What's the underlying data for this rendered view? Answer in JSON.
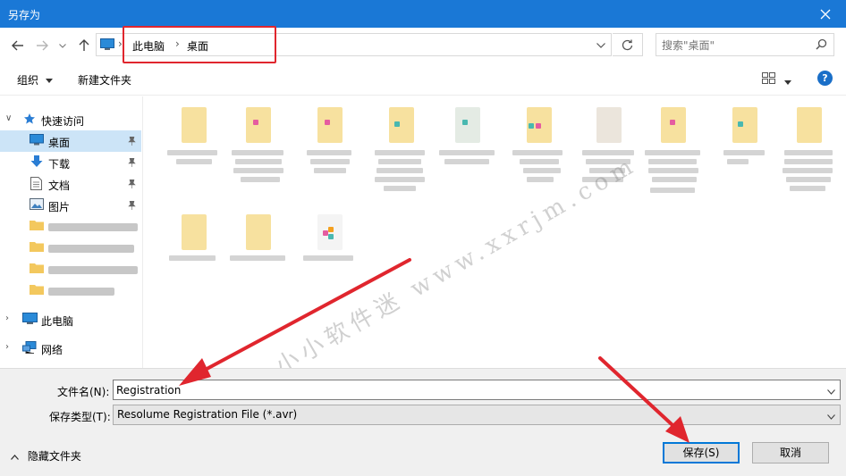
{
  "window": {
    "title": "另存为"
  },
  "address": {
    "segments": [
      "此电脑",
      "桌面"
    ]
  },
  "search": {
    "placeholder": "搜索\"桌面\""
  },
  "toolbar": {
    "organize": "组织",
    "new_folder": "新建文件夹",
    "help": "?"
  },
  "nav": {
    "quick_access": "快速访问",
    "items": [
      {
        "label": "桌面",
        "icon": "desktop-icon",
        "pinned": true
      },
      {
        "label": "下载",
        "icon": "download-icon",
        "pinned": true
      },
      {
        "label": "文档",
        "icon": "document-icon",
        "pinned": true
      },
      {
        "label": "图片",
        "icon": "picture-icon",
        "pinned": true
      }
    ],
    "this_pc": "此电脑",
    "network": "网络"
  },
  "form": {
    "filename_label": "文件名(N):",
    "filename_value": "Registration",
    "type_label": "保存类型(T):",
    "type_value": "Resolume Registration File (*.avr)"
  },
  "footer": {
    "hide_folders": "隐藏文件夹",
    "save": "保存(S)",
    "cancel": "取消"
  },
  "watermark": "小小软件迷 www.xxrjm.com",
  "colors": {
    "titlebar": "#1a78d6",
    "accent": "#0078d7",
    "annotation": "#e0262e",
    "selection": "#cce4f7"
  }
}
